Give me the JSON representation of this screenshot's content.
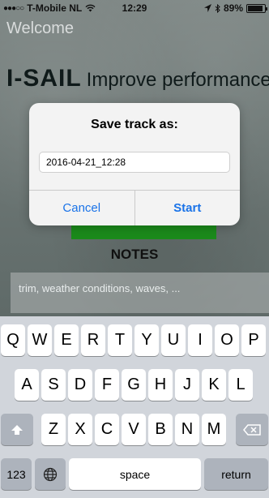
{
  "status_bar": {
    "carrier": "T-Mobile NL",
    "time": "12:29",
    "battery": "89%",
    "battery_level": 0.89,
    "icons": [
      "signal-dots",
      "wifi-icon",
      "location-arrow-icon",
      "bluetooth-icon",
      "battery-icon"
    ]
  },
  "app": {
    "welcome": "Welcome",
    "logo": "I-SAIL",
    "tagline": "Improve performance",
    "notes_heading": "NOTES",
    "notes_placeholder": "trim, weather conditions, waves, ...",
    "accent_color": "#1b8a1b"
  },
  "dialog": {
    "title": "Save track as:",
    "input_value": "2016-04-21_12:28",
    "cancel_label": "Cancel",
    "start_label": "Start",
    "button_color": "#1a73e8"
  },
  "keyboard": {
    "row1": [
      "Q",
      "W",
      "E",
      "R",
      "T",
      "Y",
      "U",
      "I",
      "O",
      "P"
    ],
    "row2": [
      "A",
      "S",
      "D",
      "F",
      "G",
      "H",
      "J",
      "K",
      "L"
    ],
    "row3": [
      "Z",
      "X",
      "C",
      "V",
      "B",
      "N",
      "M"
    ],
    "numbers_label": "123",
    "space_label": "space",
    "return_label": "return",
    "icons": [
      "shift-icon",
      "backspace-icon",
      "globe-icon"
    ]
  }
}
